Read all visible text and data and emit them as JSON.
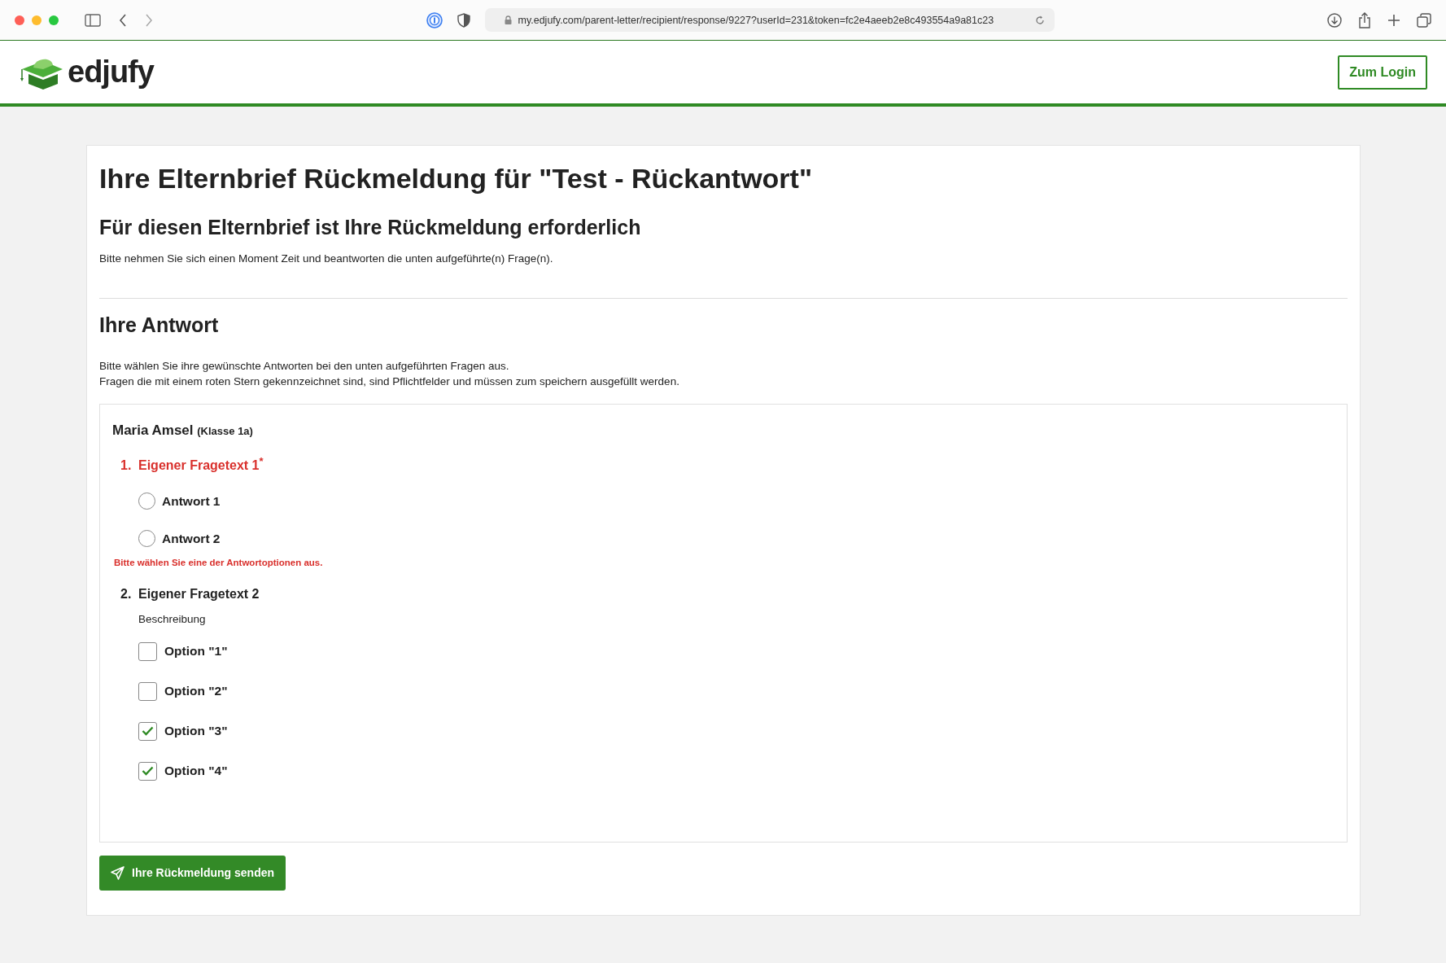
{
  "browser": {
    "url": "my.edjufy.com/parent-letter/recipient/response/9227?userId=231&token=fc2e4aeeb2e8c493554a9a81c23"
  },
  "header": {
    "logo_text": "edjufy",
    "login_button": "Zum Login"
  },
  "page": {
    "title": "Ihre Elternbrief Rückmeldung für \"Test - Rückantwort\"",
    "subtitle": "Für diesen Elternbrief ist Ihre Rückmeldung erforderlich",
    "intro": "Bitte nehmen Sie sich einen Moment Zeit und beantworten die unten aufgeführte(n) Frage(n).",
    "answer_heading": "Ihre Antwort",
    "answer_instructions": [
      "Bitte wählen Sie ihre gewünschte Antworten bei den unten aufgeführten Fragen aus.",
      "Fragen die mit einem roten Stern gekennzeichnet sind, sind Pflichtfelder und müssen zum speichern ausgefüllt werden."
    ],
    "student": {
      "name": "Maria Amsel",
      "class_label": "(Klasse 1a)"
    },
    "questions": [
      {
        "number": "1.",
        "text": "Eigener Fragetext 1",
        "required_mark": "*",
        "invalid": true,
        "kind": "radio",
        "options": [
          {
            "label": "Antwort 1",
            "selected": false
          },
          {
            "label": "Antwort 2",
            "selected": false
          }
        ],
        "error_message": "Bitte wählen Sie eine der Antwortoptionen aus."
      },
      {
        "number": "2.",
        "text": "Eigener Fragetext 2",
        "invalid": false,
        "kind": "checkbox",
        "description": "Beschreibung",
        "options": [
          {
            "label": "Option \"1\"",
            "checked": false
          },
          {
            "label": "Option \"2\"",
            "checked": false
          },
          {
            "label": "Option \"3\"",
            "checked": true
          },
          {
            "label": "Option \"4\"",
            "checked": true
          }
        ]
      }
    ],
    "submit_button": "Ihre Rückmeldung senden"
  }
}
